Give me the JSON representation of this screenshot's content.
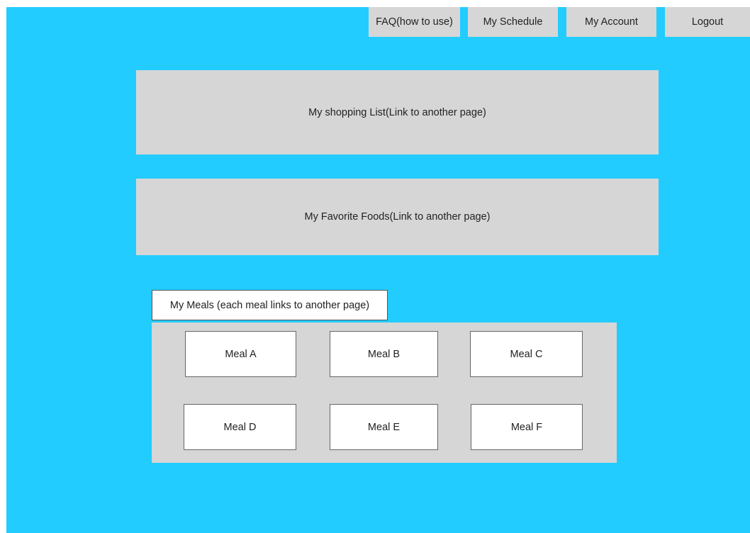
{
  "nav": {
    "faq": "FAQ(how to use)",
    "schedule": "My Schedule",
    "account": "My Account",
    "logout": "Logout"
  },
  "links": {
    "shopping_list": "My shopping List(Link to another page)",
    "favorite_foods": "My Favorite Foods(Link to another page)"
  },
  "meals": {
    "label": "My Meals (each meal links to another page)",
    "items": [
      "Meal A",
      "Meal B",
      "Meal C",
      "Meal D",
      "Meal E",
      "Meal F"
    ]
  },
  "colors": {
    "background": "#22ccff",
    "panel": "#d6d6d6",
    "card": "#ffffff"
  }
}
